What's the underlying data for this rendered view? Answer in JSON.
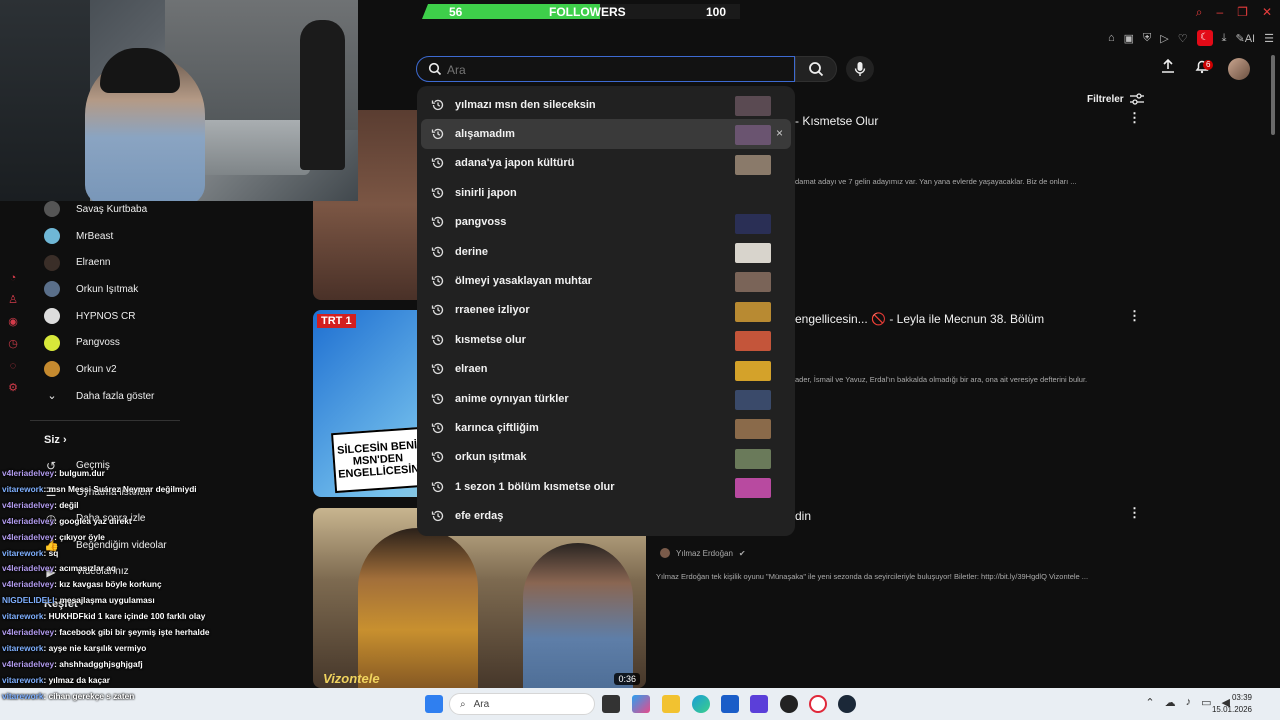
{
  "stream": {
    "followers_label": "FOLLOWERS",
    "followers_current": "56",
    "followers_goal": "100",
    "progress_fraction": 0.56
  },
  "search": {
    "placeholder": "Ara",
    "suggestions": [
      {
        "text": "yılmazı msn den sileceksin",
        "thumb": "#5a4a52"
      },
      {
        "text": "alışamadım",
        "thumb": "#6a5470",
        "remove": "×"
      },
      {
        "text": "adana'ya japon kültürü",
        "thumb": "#8a7a6a"
      },
      {
        "text": "sinirli japon",
        "thumb": ""
      },
      {
        "text": "pangvoss",
        "thumb": "#2a2f55"
      },
      {
        "text": "derine",
        "thumb": "#d8d4cc"
      },
      {
        "text": "ölmeyi yasaklayan muhtar",
        "thumb": "#7a6458"
      },
      {
        "text": "rraenee izliyor",
        "thumb": "#b88a32"
      },
      {
        "text": "kısmetse olur",
        "thumb": "#c4553a"
      },
      {
        "text": "elraen",
        "thumb": "#d4a22a"
      },
      {
        "text": "anime oynıyan türkler",
        "thumb": "#3a4a6a"
      },
      {
        "text": "karınca çiftliğim",
        "thumb": "#8a6a4a"
      },
      {
        "text": "orkun ışıtmak",
        "thumb": "#6a7a5a"
      },
      {
        "text": "1 sezon 1 bölüm kısmetse olur",
        "thumb": "#b84aa0"
      },
      {
        "text": "efe erdaş",
        "thumb": ""
      }
    ]
  },
  "header": {
    "filters_label": "Filtreler",
    "notifications_count": "6"
  },
  "sidebar": {
    "subscriptions": [
      {
        "name": "Savaş Kurtbaba",
        "color": "#555"
      },
      {
        "name": "MrBeast",
        "color": "#6fb7d6"
      },
      {
        "name": "Elraenn",
        "color": "#3a2e28"
      },
      {
        "name": "Orkun Işıtmak",
        "color": "#5a6f8a"
      },
      {
        "name": "HYPNOS CR",
        "color": "#ddd"
      },
      {
        "name": "Pangvoss",
        "color": "#d7e83a"
      },
      {
        "name": "Orkun v2",
        "color": "#c58a2f"
      }
    ],
    "show_more": "Daha fazla göster",
    "you_section": "Siz",
    "nav": [
      {
        "label": "Geçmiş",
        "icon": "history-icon"
      },
      {
        "label": "Oynatma listeleri",
        "icon": "playlist-icon"
      },
      {
        "label": "Daha sonra izle",
        "icon": "clock-icon"
      },
      {
        "label": "Beğendiğim videolar",
        "icon": "like-icon"
      },
      {
        "label": "Videolarınız",
        "icon": "video-icon"
      }
    ],
    "explore": "Keşfet"
  },
  "chat": [
    {
      "user": "v4leriadelvey",
      "text": ": bulgum.dur"
    },
    {
      "user": "vitarework",
      "text": ": msn Messi Suárez Neymar değilmiydi"
    },
    {
      "user": "v4leriadelvey",
      "text": ": değil"
    },
    {
      "user": "v4leriadelvey",
      "text": ": googlea yaz direkt"
    },
    {
      "user": "v4leriadelvey",
      "text": ": çıkıyor öyle"
    },
    {
      "user": "vitarework",
      "text": ": sq"
    },
    {
      "user": "v4leriadelvey",
      "text": ": acımasızlar aq"
    },
    {
      "user": "v4leriadelvey",
      "text": ": kız kavgası böyle korkunç"
    },
    {
      "user": "NIGDELIDELI",
      "text": ": mesajlaşma uygulaması"
    },
    {
      "user": "vitarework",
      "text": ": HUKHDFkid 1 kare içinde 100 farklı olay"
    },
    {
      "user": "v4leriadelvey",
      "text": ": facebook gibi bir şeymiş işte herhalde"
    },
    {
      "user": "vitarework",
      "text": ": ayşe nie karşılık vermiyo"
    },
    {
      "user": "v4leriadelvey",
      "text": ": ahshhadgghjsghjgafj"
    },
    {
      "user": "vitarework",
      "text": ": yılmaz da kaçar"
    },
    {
      "user": "vitarework",
      "text": ": cihan gerekçe s zaten"
    }
  ],
  "videos": [
    {
      "title": "- Kısmetse Olur",
      "desc": "damat adayı ve 7 gelin adayımız var. Yan yana evlerde yaşayacaklar. Biz de onları ..."
    },
    {
      "title": "engellicesin... 🚫 - Leyla ile Mecnun 38. Bölüm",
      "desc": "ader, İsmail ve Yavuz, Erdal'ın bakkalda olmadığı bir ara, ona ait veresiye defterini bulur.",
      "badge": "TRT 1",
      "comic": "SİLCESİN BENİ MSN'DEN ENGELLİCESİN"
    },
    {
      "title": "din",
      "channel": "Yılmaz Erdoğan",
      "desc": "Yılmaz Erdoğan tek kişilik oyunu \"Münaşaka\" ile yeni sezonda da seyircileriyle buluşuyor! Biletler: http://bit.ly/39HgdlQ Vizontele ...",
      "brand": "Vizontele",
      "duration": "0:36"
    }
  ],
  "taskbar": {
    "search_placeholder": "Ara",
    "time": "03:39",
    "date": "15.01.2026"
  }
}
